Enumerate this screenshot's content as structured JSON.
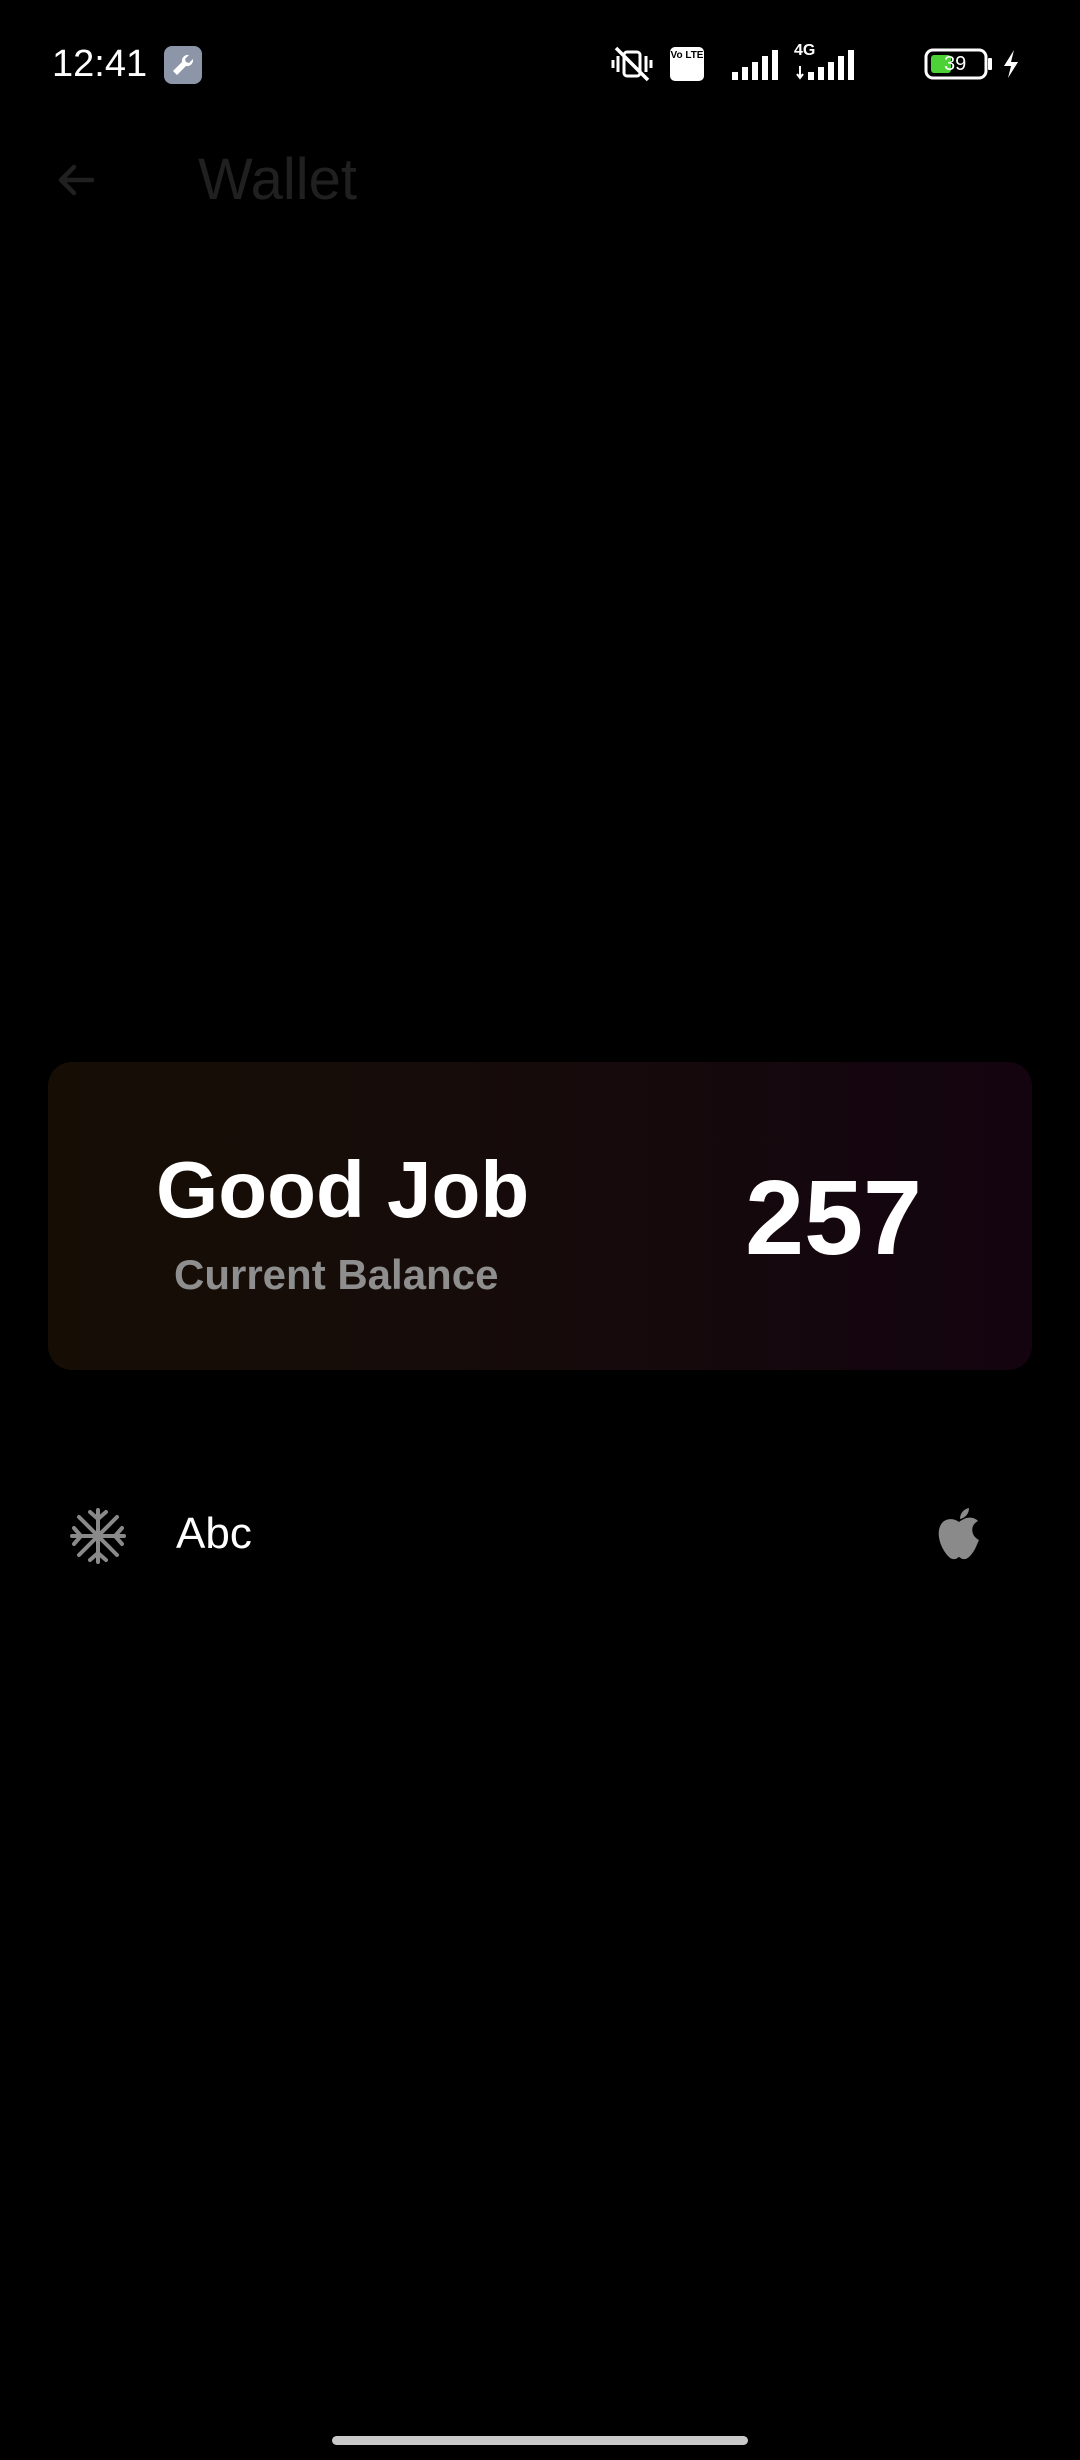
{
  "status_bar": {
    "time": "12:41",
    "app_icon": "wrench-icon",
    "network_type": "4G",
    "volte_label": "Vo LTE",
    "battery_level": "39",
    "icons": [
      "mute-vibrate-icon",
      "volte-icon",
      "signal-icon",
      "signal-4g-icon",
      "battery-icon",
      "charging-icon"
    ]
  },
  "top_bar": {
    "back_icon": "arrow-left-icon",
    "title": "Wallet"
  },
  "balance_card": {
    "heading": "Good Job",
    "subtitle": "Current Balance",
    "value": "257"
  },
  "list": {
    "items": [
      {
        "leading_icon": "snowflake-icon",
        "label": "Abc",
        "trailing_icon": "apple-icon"
      }
    ]
  },
  "colors": {
    "background": "#000000",
    "title_dim": "#202020",
    "subtitle": "#8e8e8e",
    "battery_green": "#4cd137"
  }
}
